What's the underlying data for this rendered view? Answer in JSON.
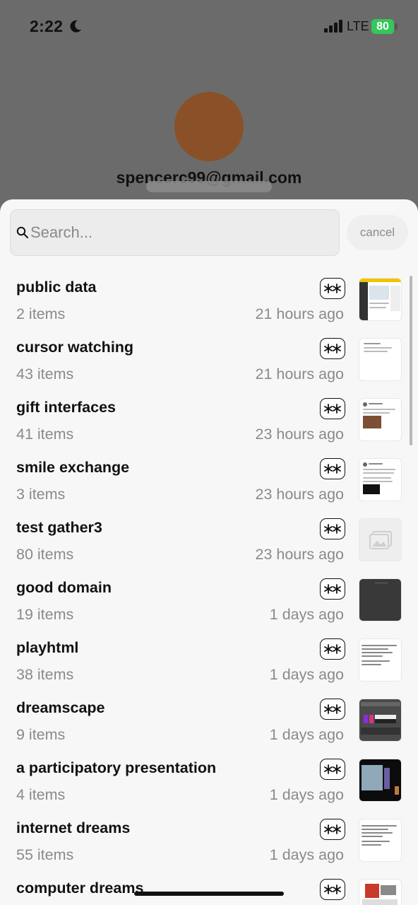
{
  "status_bar": {
    "time": "2:22",
    "network": "LTE",
    "battery": "80"
  },
  "profile": {
    "email": "spencerc99@gmail.com"
  },
  "search": {
    "placeholder": "Search...",
    "value": "",
    "cancel_label": "cancel"
  },
  "collections": [
    {
      "title": "public data",
      "count": "2 items",
      "time": "21 hours ago",
      "thumb": "screenshot-page"
    },
    {
      "title": "cursor watching",
      "count": "43 items",
      "time": "21 hours ago",
      "thumb": "text-doc"
    },
    {
      "title": "gift interfaces",
      "count": "41 items",
      "time": "23 hours ago",
      "thumb": "post-with-photo"
    },
    {
      "title": "smile exchange",
      "count": "3 items",
      "time": "23 hours ago",
      "thumb": "post-with-dark-image"
    },
    {
      "title": "test gather3",
      "count": "80 items",
      "time": "23 hours ago",
      "thumb": "image-placeholder-icon"
    },
    {
      "title": "good domain",
      "count": "19 items",
      "time": "1 days ago",
      "thumb": "dark-screen"
    },
    {
      "title": "playhtml",
      "count": "38 items",
      "time": "1 days ago",
      "thumb": "code-text"
    },
    {
      "title": "dreamscape",
      "count": "9 items",
      "time": "1 days ago",
      "thumb": "app-screenshot"
    },
    {
      "title": "a participatory presentation",
      "count": "4 items",
      "time": "1 days ago",
      "thumb": "presentation-photo"
    },
    {
      "title": "internet dreams",
      "count": "55 items",
      "time": "1 days ago",
      "thumb": "code-text"
    },
    {
      "title": "computer dreams",
      "count": "",
      "time": "",
      "thumb": "collage"
    }
  ]
}
